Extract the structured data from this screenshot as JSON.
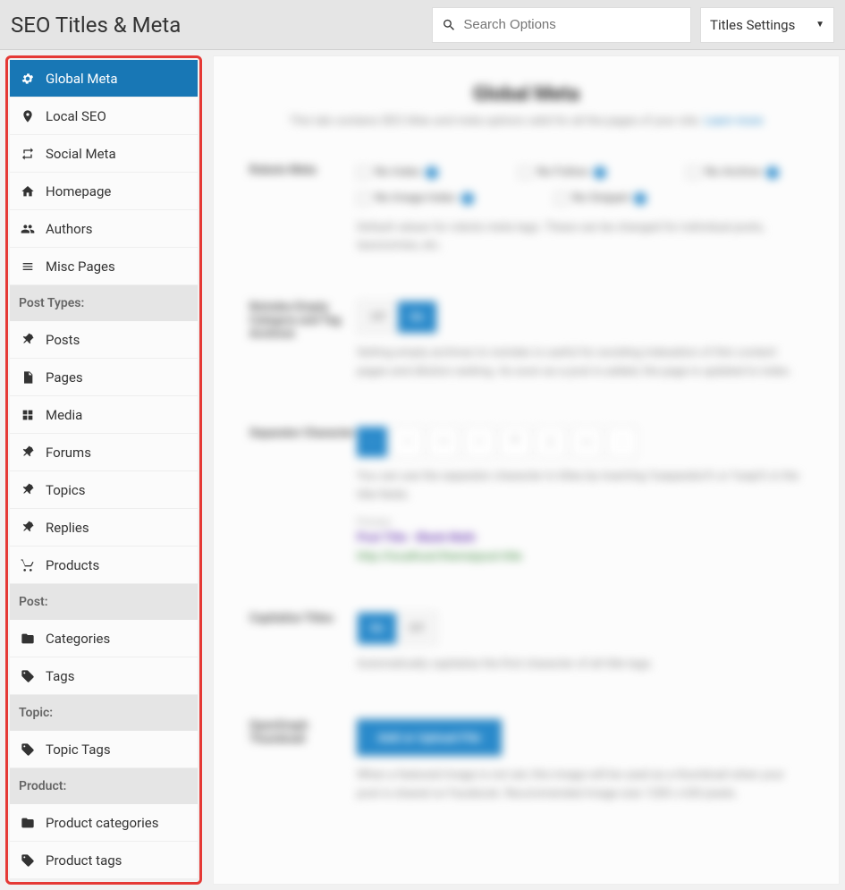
{
  "header": {
    "title": "SEO Titles & Meta",
    "search_placeholder": "Search Options",
    "select_label": "Titles Settings"
  },
  "sidebar": {
    "main": [
      {
        "label": "Global Meta",
        "icon": "gear",
        "active": true
      },
      {
        "label": "Local SEO",
        "icon": "pin",
        "active": false
      },
      {
        "label": "Social Meta",
        "icon": "retweet",
        "active": false
      },
      {
        "label": "Homepage",
        "icon": "home",
        "active": false
      },
      {
        "label": "Authors",
        "icon": "users",
        "active": false
      },
      {
        "label": "Misc Pages",
        "icon": "stack",
        "active": false
      }
    ],
    "section_post_types": "Post Types:",
    "post_types": [
      {
        "label": "Posts",
        "icon": "pin2"
      },
      {
        "label": "Pages",
        "icon": "file"
      },
      {
        "label": "Media",
        "icon": "media"
      },
      {
        "label": "Forums",
        "icon": "pin2"
      },
      {
        "label": "Topics",
        "icon": "pin2"
      },
      {
        "label": "Replies",
        "icon": "pin2"
      },
      {
        "label": "Products",
        "icon": "cart"
      }
    ],
    "section_post": "Post:",
    "post": [
      {
        "label": "Categories",
        "icon": "folder"
      },
      {
        "label": "Tags",
        "icon": "tag"
      }
    ],
    "section_topic": "Topic:",
    "topic": [
      {
        "label": "Topic Tags",
        "icon": "tag"
      }
    ],
    "section_product": "Product:",
    "product": [
      {
        "label": "Product categories",
        "icon": "folder"
      },
      {
        "label": "Product tags",
        "icon": "tag"
      }
    ]
  },
  "content": {
    "heading": "Global Meta",
    "subtext": "This tab contains SEO titles and meta options valid for all the pages of your site.",
    "sublink": "Learn more",
    "r1_label": "Robots Meta",
    "r1_checks": [
      "No Index",
      "No Follow",
      "No Archive",
      "No Image Index",
      "No Snippet"
    ],
    "r1_desc": "Default values for robots meta tags. These can be changed for individual posts, taxonomies, etc.",
    "r2_label": "Noindex Empty Category and Tag Archives",
    "r2_on": "On",
    "r2_off": "Off",
    "r2_desc": "Setting empty archives to noindex is useful for avoiding indexation of thin content pages and dilution ranking. As soon as a post is added, the page is updated to index.",
    "r3_label": "Separator Character",
    "r3_chars": [
      "-",
      "–",
      "—",
      "•",
      "*",
      "|",
      "~",
      ":"
    ],
    "r3_desc": "You can use the separator character in titles by inserting %separator% or %sep% in the title fields.",
    "r3_preview": "Preview",
    "r3_prev1": "Post Title - Blank Math",
    "r3_prev2": "http://localhost/theme|post-title",
    "r4_label": "Capitalize Titles",
    "r4_desc": "Automatically capitalize the first character of all title tags.",
    "r5_label": "OpenGraph Thumbnail",
    "r5_btn": "Add or Upload File",
    "r5_desc": "When a featured image is not set, this image will be used as a thumbnail when your post is shared on Facebook. Recommended image size 1200 x 630 pixels."
  }
}
